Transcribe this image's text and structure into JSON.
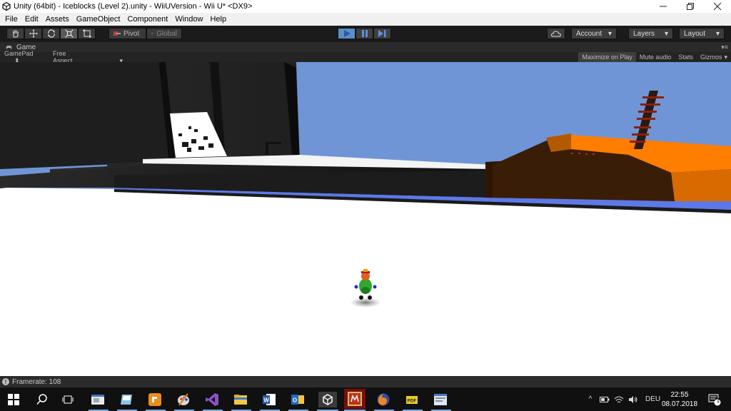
{
  "window": {
    "title": "Unity (64bit) - Iceblocks (Level 2).unity - WiiUVersion - Wii U* <DX9>"
  },
  "menu": [
    "File",
    "Edit",
    "Assets",
    "GameObject",
    "Component",
    "Window",
    "Help"
  ],
  "toolbar": {
    "pivot_label": "Pivot",
    "global_label": "Global",
    "account_label": "Account",
    "layers_label": "Layers",
    "layout_label": "Layout"
  },
  "game_tab": {
    "tab_label": "Game",
    "display_label": "GamePad",
    "aspect_label": "Free Aspect",
    "maximize_label": "Maximize on Play",
    "mute_label": "Mute audio",
    "stats_label": "Stats",
    "gizmos_label": "Gizmos"
  },
  "status": {
    "text": "Framerate: 108"
  },
  "taskbar": {
    "language": "DEU",
    "time": "22:55",
    "date": "08.07.2018",
    "notification_count": "1"
  },
  "colors": {
    "sky": "#7095d6",
    "water": "#5d79e6",
    "orange_platform": "#ff7e00",
    "play_active": "#5b8fc7"
  }
}
